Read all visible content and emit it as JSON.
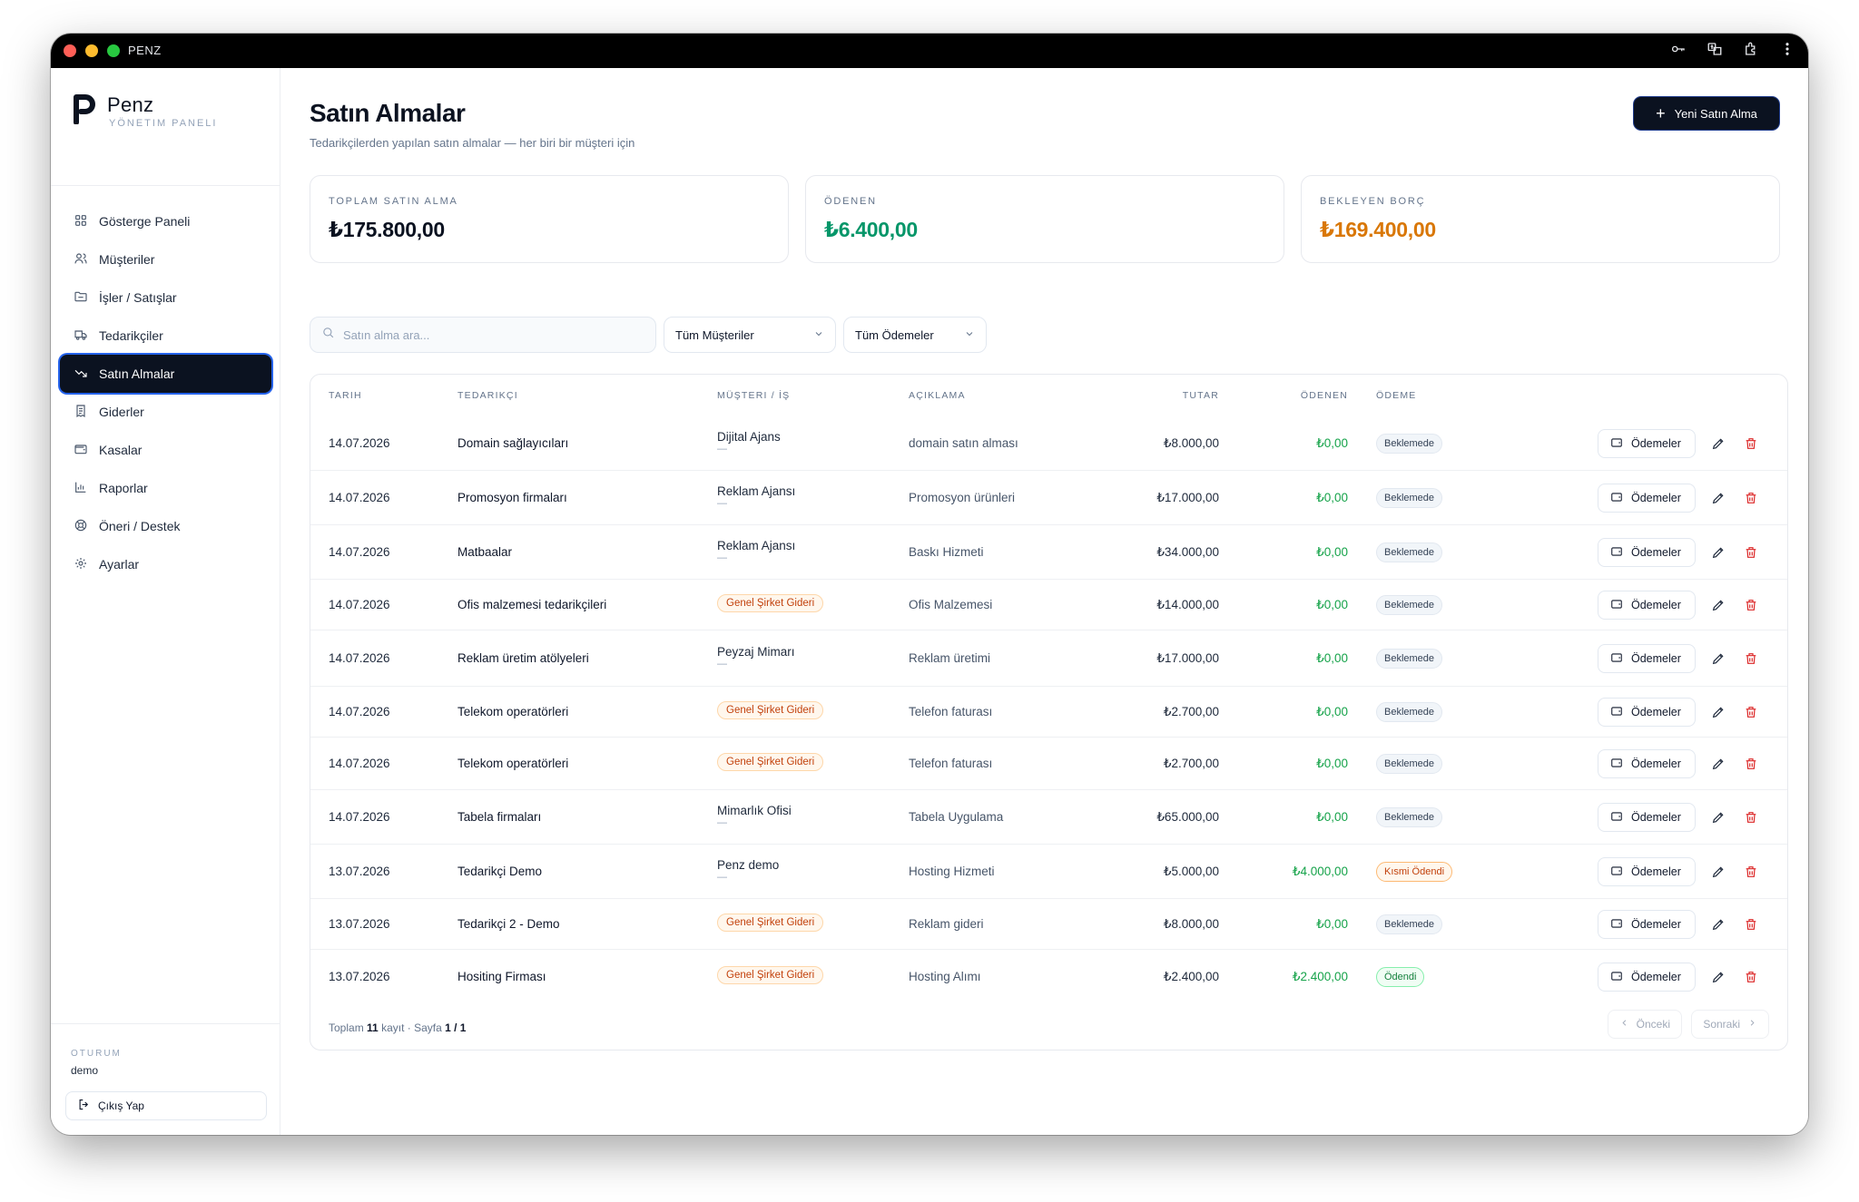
{
  "window": {
    "title": "PENZ"
  },
  "brand": {
    "name": "Penz",
    "subtitle": "YÖNETIM PANELI"
  },
  "sidebar": {
    "items": [
      {
        "label": "Gösterge Paneli",
        "icon": "dashboard-icon",
        "active": false
      },
      {
        "label": "Müşteriler",
        "icon": "users-icon",
        "active": false
      },
      {
        "label": "İşler / Satışlar",
        "icon": "folder-icon",
        "active": false
      },
      {
        "label": "Tedarikçiler",
        "icon": "truck-icon",
        "active": false
      },
      {
        "label": "Satın Almalar",
        "icon": "trend-down-icon",
        "active": true
      },
      {
        "label": "Giderler",
        "icon": "receipt-icon",
        "active": false
      },
      {
        "label": "Kasalar",
        "icon": "wallet-icon",
        "active": false
      },
      {
        "label": "Raporlar",
        "icon": "bar-chart-icon",
        "active": false
      },
      {
        "label": "Öneri / Destek",
        "icon": "lifebuoy-icon",
        "active": false
      },
      {
        "label": "Ayarlar",
        "icon": "gear-icon",
        "active": false
      }
    ],
    "session_label": "OTURUM",
    "session_user": "demo",
    "logout_label": "Çıkış Yap"
  },
  "header": {
    "title": "Satın Almalar",
    "subtitle": "Tedarikçilerden yapılan satın almalar — her biri bir müşteri için",
    "new_button": "Yeni Satın Alma"
  },
  "stats": {
    "total": {
      "label": "TOPLAM SATIN ALMA",
      "value": "₺175.800,00",
      "color": "#0b1220"
    },
    "paid": {
      "label": "ÖDENEN",
      "value": "₺6.400,00",
      "color": "#059669"
    },
    "debt": {
      "label": "BEKLEYEN BORÇ",
      "value": "₺169.400,00",
      "color": "#d97706"
    }
  },
  "filters": {
    "search_placeholder": "Satın alma ara...",
    "customer_select": "Tüm Müşteriler",
    "payment_select": "Tüm Ödemeler"
  },
  "table": {
    "headers": {
      "date": "TARIH",
      "supplier": "TEDARIKÇI",
      "customer": "MÜŞTERI / İŞ",
      "description": "AÇIKLAMA",
      "total": "TUTAR",
      "paid": "ÖDENEN",
      "status": "ÖDEME"
    },
    "payments_button": "Ödemeler",
    "rows": [
      {
        "date": "14.07.2026",
        "supplier": "Domain sağlayıcıları",
        "customer": "Dijital Ajans",
        "customer_sub": "—",
        "general": false,
        "description": "domain satın alması",
        "total": "₺8.000,00",
        "paid": "₺0,00",
        "status": "Beklemede",
        "status_type": "wait"
      },
      {
        "date": "14.07.2026",
        "supplier": "Promosyon firmaları",
        "customer": "Reklam Ajansı",
        "customer_sub": "—",
        "general": false,
        "description": "Promosyon ürünleri",
        "total": "₺17.000,00",
        "paid": "₺0,00",
        "status": "Beklemede",
        "status_type": "wait"
      },
      {
        "date": "14.07.2026",
        "supplier": "Matbaalar",
        "customer": "Reklam Ajansı",
        "customer_sub": "—",
        "general": false,
        "description": "Baskı Hizmeti",
        "total": "₺34.000,00",
        "paid": "₺0,00",
        "status": "Beklemede",
        "status_type": "wait"
      },
      {
        "date": "14.07.2026",
        "supplier": "Ofis malzemesi tedarikçileri",
        "customer": "Genel Şirket Gideri",
        "customer_sub": "",
        "general": true,
        "description": "Ofis Malzemesi",
        "total": "₺14.000,00",
        "paid": "₺0,00",
        "status": "Beklemede",
        "status_type": "wait"
      },
      {
        "date": "14.07.2026",
        "supplier": "Reklam üretim atölyeleri",
        "customer": "Peyzaj Mimarı",
        "customer_sub": "—",
        "general": false,
        "description": "Reklam üretimi",
        "total": "₺17.000,00",
        "paid": "₺0,00",
        "status": "Beklemede",
        "status_type": "wait"
      },
      {
        "date": "14.07.2026",
        "supplier": "Telekom operatörleri",
        "customer": "Genel Şirket Gideri",
        "customer_sub": "",
        "general": true,
        "description": "Telefon faturası",
        "total": "₺2.700,00",
        "paid": "₺0,00",
        "status": "Beklemede",
        "status_type": "wait"
      },
      {
        "date": "14.07.2026",
        "supplier": "Telekom operatörleri",
        "customer": "Genel Şirket Gideri",
        "customer_sub": "",
        "general": true,
        "description": "Telefon faturası",
        "total": "₺2.700,00",
        "paid": "₺0,00",
        "status": "Beklemede",
        "status_type": "wait"
      },
      {
        "date": "14.07.2026",
        "supplier": "Tabela firmaları",
        "customer": "Mimarlık Ofisi",
        "customer_sub": "—",
        "general": false,
        "description": "Tabela Uygulama",
        "total": "₺65.000,00",
        "paid": "₺0,00",
        "status": "Beklemede",
        "status_type": "wait"
      },
      {
        "date": "13.07.2026",
        "supplier": "Tedarikçi Demo",
        "customer": "Penz demo",
        "customer_sub": "—",
        "general": false,
        "description": "Hosting Hizmeti",
        "total": "₺5.000,00",
        "paid": "₺4.000,00",
        "status": "Kısmi Ödendi",
        "status_type": "part"
      },
      {
        "date": "13.07.2026",
        "supplier": "Tedarikçi 2 - Demo",
        "customer": "Genel Şirket Gideri",
        "customer_sub": "",
        "general": true,
        "description": "Reklam gideri",
        "total": "₺8.000,00",
        "paid": "₺0,00",
        "status": "Beklemede",
        "status_type": "wait"
      },
      {
        "date": "13.07.2026",
        "supplier": "Hositing Firması",
        "customer": "Genel Şirket Gideri",
        "customer_sub": "",
        "general": true,
        "description": "Hosting Alımı",
        "total": "₺2.400,00",
        "paid": "₺2.400,00",
        "status": "Ödendi",
        "status_type": "done"
      }
    ]
  },
  "pagination": {
    "prefix": "Toplam",
    "count": "11",
    "middle": "kayıt · Sayfa",
    "page": "1 / 1",
    "prev": "Önceki",
    "next": "Sonraki"
  }
}
